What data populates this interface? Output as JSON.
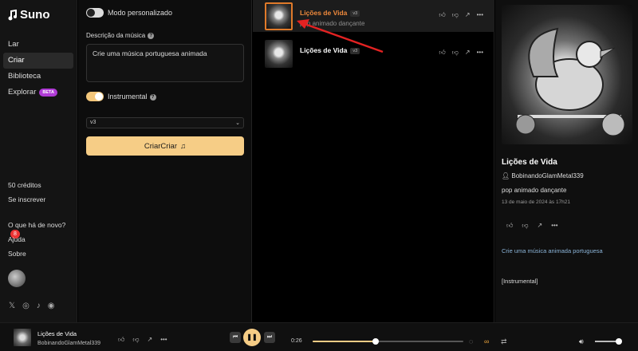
{
  "app": {
    "name": "Suno"
  },
  "sidebar": {
    "items": [
      {
        "label": "Lar"
      },
      {
        "label": "Criar"
      },
      {
        "label": "Biblioteca"
      },
      {
        "label": "Explorar",
        "badge": "BETA"
      }
    ],
    "credits": "50 créditos",
    "subscribe": "Se inscrever",
    "whats_new": "O que há de novo?",
    "whats_new_count": "8",
    "help": "Ajuda",
    "about": "Sobre"
  },
  "create": {
    "custom_mode_label": "Modo personalizado",
    "description_label": "Descrição da música",
    "description_value": "Crie uma música portuguesa animada",
    "instrumental_label": "Instrumental",
    "version": "v3",
    "create_button": "CriarCriar"
  },
  "songs": [
    {
      "title": "Lições de Vida",
      "version": "v3",
      "genre": "pop animado dançante",
      "selected": true
    },
    {
      "title": "Lições de Vida",
      "version": "v3",
      "genre": "",
      "selected": false
    }
  ],
  "detail": {
    "title": "Lições de Vida",
    "user": "BobinandoGlamMetal339",
    "genre": "pop animado dançante",
    "date": "13 de maio de 2024 às 17h21",
    "prompt": "Crie uma música animada portuguesa",
    "lyrics": "[Instrumental]"
  },
  "player": {
    "title": "Lições de Vida",
    "user": "BobinandoGlamMetal339",
    "time": "0:26",
    "progress": 0.42,
    "volume": 0.9
  },
  "colors": {
    "accent": "#f6cd86",
    "selected_title": "#f08a3c",
    "notif": "#e33333",
    "beta": "#b03bd6"
  }
}
